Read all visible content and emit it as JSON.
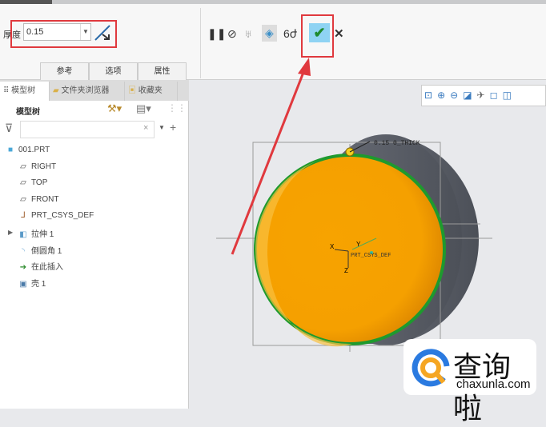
{
  "ribbon": {
    "thickness_label": "厚度",
    "thickness_value": "0.15",
    "tabs": [
      "参考",
      "选项",
      "属性"
    ],
    "tools": {
      "pause": "❚❚",
      "stop": "⊘",
      "preview": "♅",
      "verify": "◈",
      "glasses": "6ժ",
      "ok": "✔",
      "cancel": "✕"
    }
  },
  "panel": {
    "tabs": [
      "模型树",
      "文件夹浏览器",
      "收藏夹"
    ],
    "header": "模型树",
    "items": [
      {
        "label": "001.PRT",
        "icon": "part-icon"
      },
      {
        "label": "RIGHT",
        "icon": "plane-icon"
      },
      {
        "label": "TOP",
        "icon": "plane-icon"
      },
      {
        "label": "FRONT",
        "icon": "plane-icon"
      },
      {
        "label": "PRT_CSYS_DEF",
        "icon": "csys-icon"
      },
      {
        "label": "拉伸 1",
        "icon": "extrude-icon"
      },
      {
        "label": "倒圆角 1",
        "icon": "round-icon"
      },
      {
        "label": "在此插入",
        "icon": "insert-arrow-icon"
      },
      {
        "label": "壳 1",
        "icon": "shell-icon"
      }
    ]
  },
  "viewport": {
    "dimension_label": "0.15 0_THICK",
    "csys_label": "PRT_CSYS_DEF",
    "axis_x": "X",
    "axis_y": "Y",
    "axis_z": "Z"
  },
  "watermark": {
    "brand": "查询啦",
    "url": "chaxunla.com"
  },
  "colors": {
    "accent_red": "#e0393e",
    "shell_orange": "#f5a100",
    "edge_green": "#1e9a2e"
  }
}
